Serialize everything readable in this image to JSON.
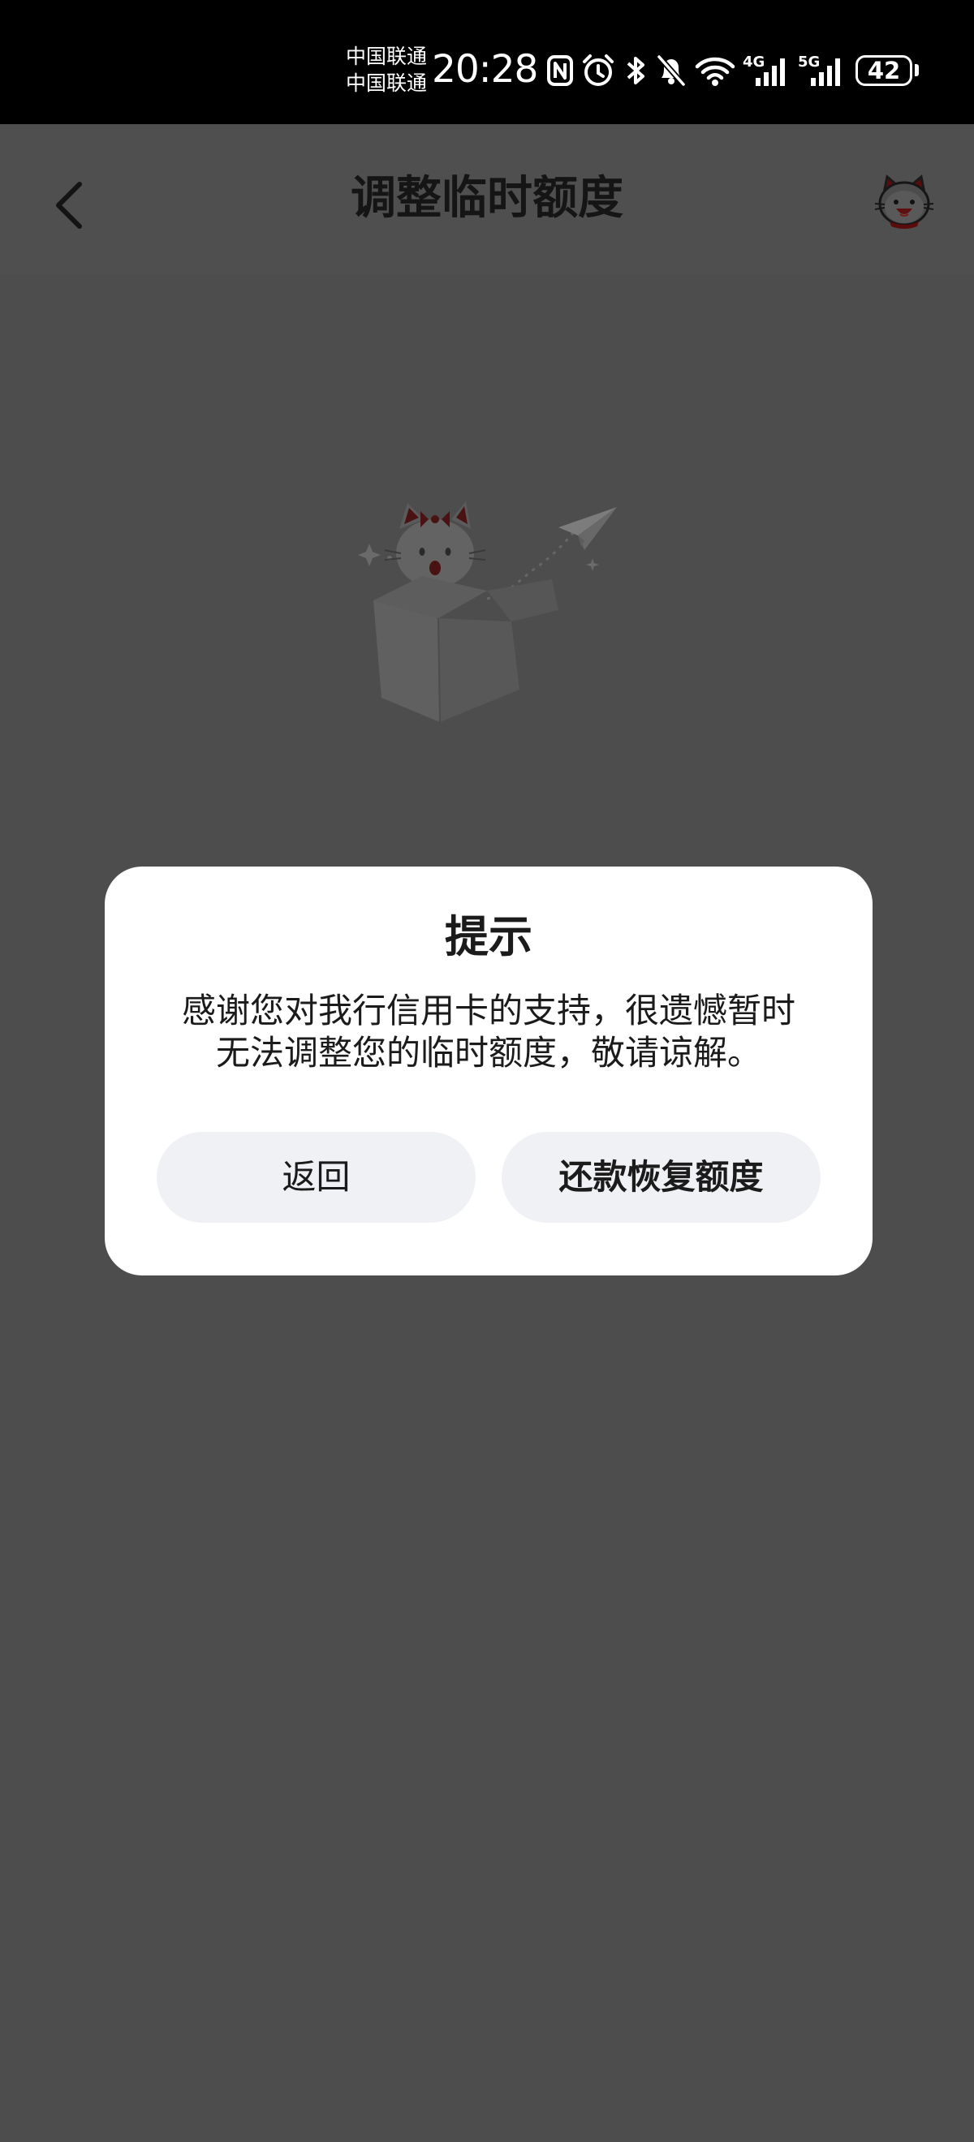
{
  "status_bar": {
    "carrier_1": "中国联通",
    "carrier_2": "中国联通",
    "time": "20:28",
    "icons": [
      "nfc-icon",
      "alarm-icon",
      "bluetooth-icon",
      "mute-icon",
      "wifi-icon",
      "signal-4g-icon",
      "signal-5g-icon"
    ],
    "signal_4g_label": "4G",
    "signal_5g_label": "5G",
    "battery": "42"
  },
  "nav": {
    "title": "调整临时额度",
    "back_icon": "chevron-left-icon",
    "mascot_icon": "mascot-cat-icon"
  },
  "empty_state": {
    "illustration": "cat-in-box-paper-plane"
  },
  "dialog": {
    "title": "提示",
    "message_line_1": "感谢您对我行信用卡的支持，很遗憾暂时",
    "message_line_2": "无法调整您的临时额度，敬请谅解。",
    "back_label": "返回",
    "repay_label": "还款恢复额度"
  },
  "colors": {
    "overlay": "#4d4d4d",
    "status_bar": "#000000",
    "dialog_bg": "#ffffff",
    "button_bg": "#f0f1f5",
    "text": "#1b1b1b"
  }
}
